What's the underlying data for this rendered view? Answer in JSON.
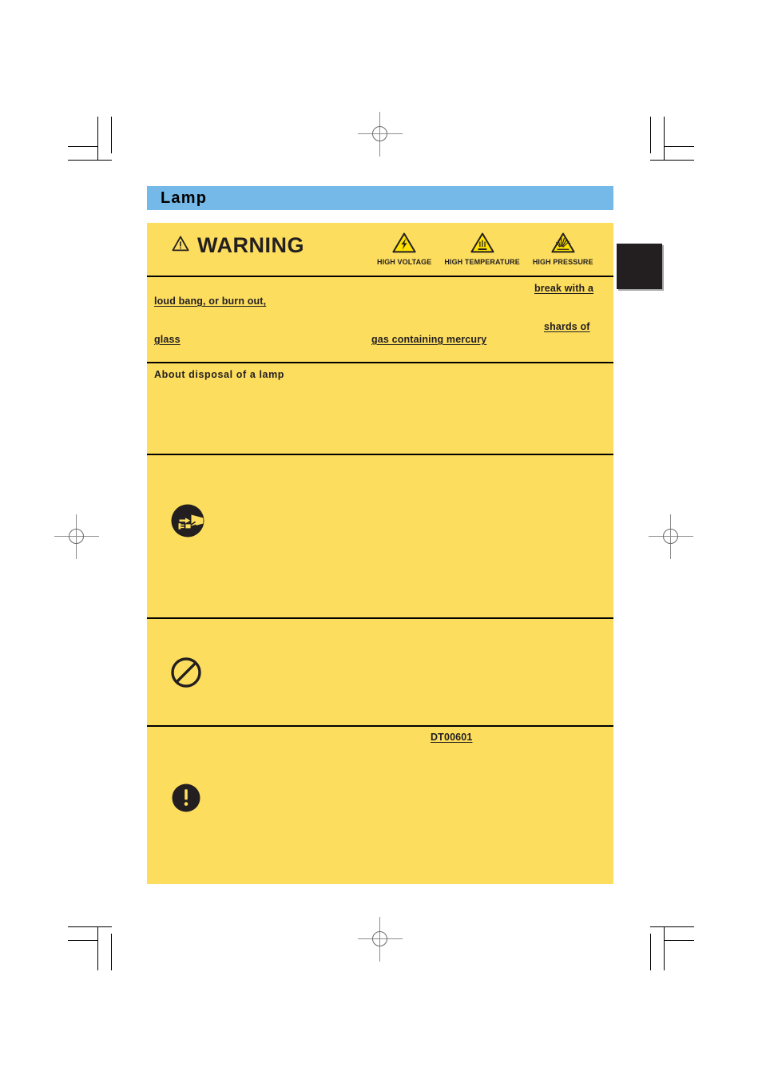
{
  "page": {
    "background_color": "#ffffff",
    "tab_marker_color": "#231f20",
    "warning_box_color": "#fcdd5d",
    "section_header_color": "#74b9e7"
  },
  "section": {
    "title": "Lamp"
  },
  "warning": {
    "label": "WARNING",
    "alert_icon": "warning-triangle-icon",
    "hazards": [
      {
        "icon": "high-voltage-triangle-icon",
        "label": "HIGH VOLTAGE"
      },
      {
        "icon": "high-temperature-triangle-icon",
        "label": "HIGH TEMPERATURE"
      },
      {
        "icon": "high-pressure-triangle-icon",
        "label": "HIGH PRESSURE"
      }
    ]
  },
  "body": {
    "fragments": [
      {
        "text": "break with a",
        "underline": true
      },
      {
        "text": "loud bang, or burn out,",
        "underline": true
      },
      {
        "text": "shards of",
        "underline": true
      },
      {
        "text": "glass",
        "underline": true
      },
      {
        "text": "gas containing mercury",
        "underline": true
      }
    ],
    "subheading": "About disposal of a lamp",
    "lamp_part_number": "DT00601"
  },
  "instruction_blocks": [
    {
      "icon": "unplug-power-cord-icon"
    },
    {
      "icon": "prohibition-icon"
    },
    {
      "icon": "mandatory-exclamation-icon"
    }
  ]
}
